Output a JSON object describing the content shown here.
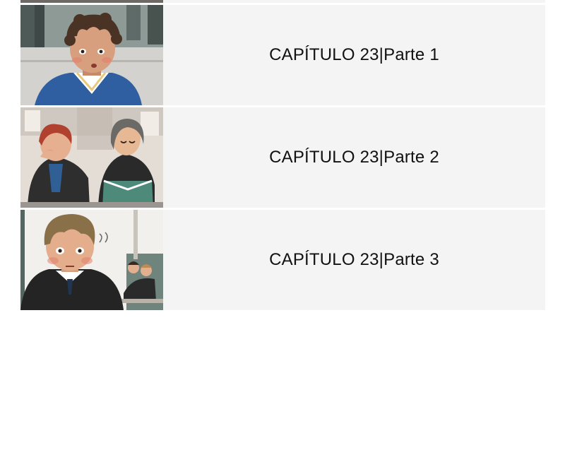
{
  "chapters": [
    {
      "label": "CAPÍTULO 23|Parte 1",
      "thumbnail": "boy-curly-hair-blue-sweater-illustration"
    },
    {
      "label": "CAPÍTULO 23|Parte 2",
      "thumbnail": "two-students-classroom-illustration"
    },
    {
      "label": "CAPÍTULO 23|Parte 3",
      "thumbnail": "boy-black-hoodie-classroom-illustration"
    }
  ],
  "colors": {
    "row_background": "#f4f4f4",
    "page_background": "#ffffff",
    "text": "#111111"
  }
}
